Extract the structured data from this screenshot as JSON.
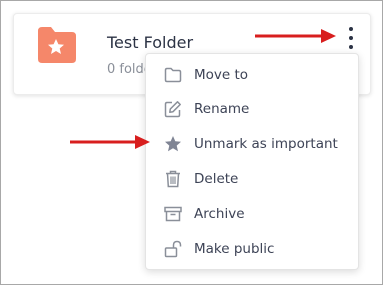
{
  "folder": {
    "title": "Test Folder",
    "subtitle": "0 folders",
    "icon": "folder-star-icon",
    "icon_color": "#f5876a"
  },
  "menu": {
    "items": [
      {
        "label": "Move to",
        "icon": "folder-icon"
      },
      {
        "label": "Rename",
        "icon": "pencil-icon"
      },
      {
        "label": "Unmark as important",
        "icon": "star-icon"
      },
      {
        "label": "Delete",
        "icon": "trash-icon"
      },
      {
        "label": "Archive",
        "icon": "archive-icon"
      },
      {
        "label": "Make public",
        "icon": "unlock-icon"
      }
    ]
  },
  "colors": {
    "annotation_arrow": "#d81e1e",
    "text": "#3d4356",
    "icon": "#8a8f99"
  }
}
